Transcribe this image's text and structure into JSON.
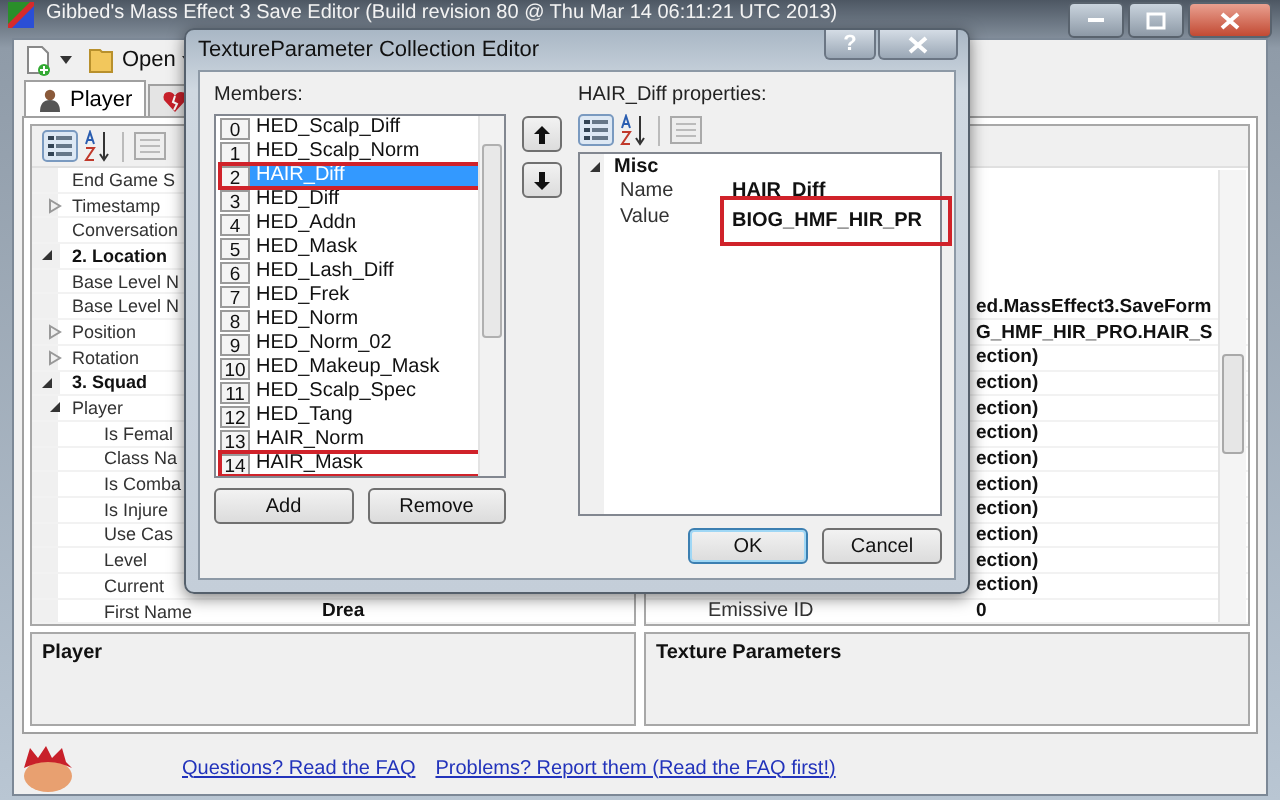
{
  "window": {
    "title": "Gibbed's Mass Effect 3 Save Editor (Build revision 80 @ Thu Mar 14 06:11:21 UTC 2013)"
  },
  "toolbar": [
    {
      "kind": "new"
    },
    {
      "kind": "open",
      "label": "Open"
    }
  ],
  "tabs": [
    {
      "label": "Player",
      "selected": true
    },
    {
      "selected": false
    }
  ],
  "player_grid": {
    "rows": [
      {
        "name": "End Game S"
      },
      {
        "name": "Timestamp",
        "expanded": false
      },
      {
        "name": "Conversation"
      },
      {
        "kind": "category",
        "name": "2. Location",
        "expanded": true,
        "children": [
          {
            "name": "Base Level N"
          },
          {
            "name": "Base Level N"
          },
          {
            "name": "Position",
            "expanded": false
          },
          {
            "name": "Rotation",
            "expanded": false
          }
        ]
      },
      {
        "kind": "category",
        "name": "3. Squad",
        "expanded": true,
        "children": [
          {
            "name": "Player",
            "expanded": true,
            "children": [
              {
                "name": "Is Femal"
              },
              {
                "name": "Class Na"
              },
              {
                "name": "Is Comba"
              },
              {
                "name": "Is Injure"
              },
              {
                "name": "Use Cas"
              },
              {
                "name": "Level"
              },
              {
                "name": "Current"
              },
              {
                "name": "First Name",
                "value": "Drea"
              }
            ]
          }
        ]
      }
    ]
  },
  "texture_grid": {
    "rows": [
      {
        "value": "ed.MassEffect3.SaveForm"
      },
      {
        "value": "G_HMF_HIR_PRO.HAIR_S"
      },
      {
        "value": "ection)"
      },
      {
        "value": "ection)"
      },
      {
        "value": "ection)"
      },
      {
        "value": "ection)"
      },
      {
        "value": "ection)"
      },
      {
        "value": "ection)"
      },
      {
        "value": "ection)"
      },
      {
        "value": "ection)"
      },
      {
        "value": "ection)"
      },
      {
        "value": "ection)"
      },
      {
        "name": "Emissive ID",
        "value": "0"
      }
    ]
  },
  "panels": [
    {
      "title": "Player"
    },
    {
      "title": "Texture Parameters"
    }
  ],
  "links": [
    "Questions? Read the FAQ",
    "Problems? Report them (Read the FAQ first!)"
  ],
  "dialog": {
    "title": "TextureParameter Collection Editor",
    "help_button": "?",
    "members_label": "Members:",
    "members": [
      {
        "index": "0",
        "name": "HED_Scalp_Diff",
        "selected": false,
        "highlighted": false
      },
      {
        "index": "1",
        "name": "HED_Scalp_Norm",
        "selected": false,
        "highlighted": false
      },
      {
        "index": "2",
        "name": "HAIR_Diff",
        "selected": true,
        "highlighted": true
      },
      {
        "index": "3",
        "name": "HED_Diff",
        "selected": false,
        "highlighted": false
      },
      {
        "index": "4",
        "name": "HED_Addn",
        "selected": false,
        "highlighted": false
      },
      {
        "index": "5",
        "name": "HED_Mask",
        "selected": false,
        "highlighted": false
      },
      {
        "index": "6",
        "name": "HED_Lash_Diff",
        "selected": false,
        "highlighted": false
      },
      {
        "index": "7",
        "name": "HED_Frek",
        "selected": false,
        "highlighted": false
      },
      {
        "index": "8",
        "name": "HED_Norm",
        "selected": false,
        "highlighted": false
      },
      {
        "index": "9",
        "name": "HED_Norm_02",
        "selected": false,
        "highlighted": false
      },
      {
        "index": "10",
        "name": "HED_Makeup_Mask",
        "selected": false,
        "highlighted": false
      },
      {
        "index": "11",
        "name": "HED_Scalp_Spec",
        "selected": false,
        "highlighted": false
      },
      {
        "index": "12",
        "name": "HED_Tang",
        "selected": false,
        "highlighted": false
      },
      {
        "index": "13",
        "name": "HAIR_Norm",
        "selected": false,
        "highlighted": false
      },
      {
        "index": "14",
        "name": "HAIR_Mask",
        "selected": false,
        "highlighted": true
      }
    ],
    "list_buttons": [
      "Add",
      "Remove"
    ],
    "properties_label": "HAIR_Diff properties:",
    "properties": [
      {
        "kind": "category",
        "name": "Misc",
        "expanded": true,
        "children": [
          {
            "name": "Name",
            "value": "HAIR_Diff",
            "highlighted": false
          },
          {
            "name": "Value",
            "value": "BIOG_HMF_HIR_PR",
            "highlighted": true
          }
        ]
      }
    ],
    "footer_buttons": [
      {
        "label": "OK",
        "default": true
      },
      {
        "label": "Cancel",
        "default": false
      }
    ]
  }
}
